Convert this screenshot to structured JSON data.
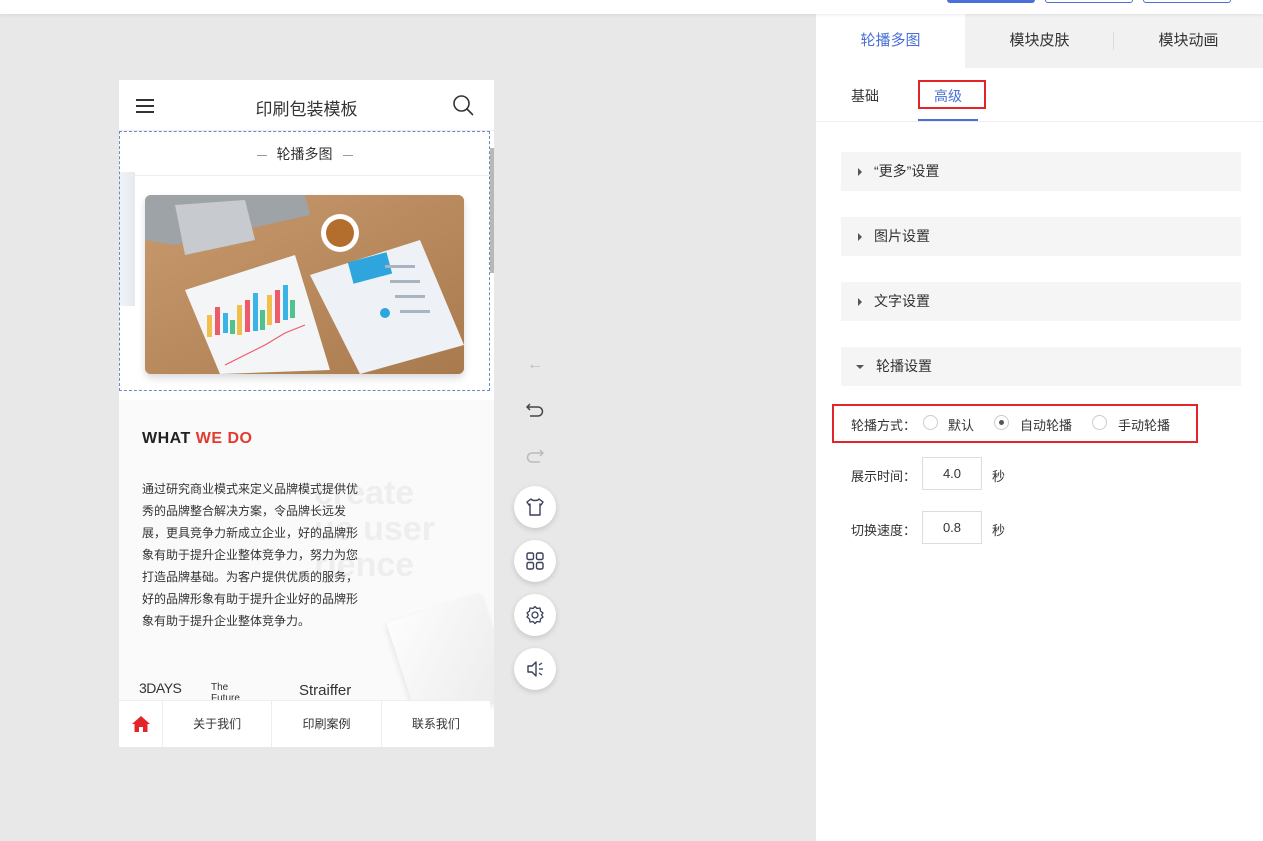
{
  "phone": {
    "title": "印刷包装模板",
    "carousel_title": "轮播多图",
    "wwd_prefix": "WHAT ",
    "wwd_highlight": "WE DO",
    "bg_line1": "create",
    "bg_line2": "ue user",
    "bg_line3": "rience",
    "paragraph": "通过研究商业模式来定义品牌模式提供优秀的品牌整合解决方案，令品牌长远发展，更具竞争力新成立企业，好的品牌形象有助于提升企业整体竞争力，努力为您打造品牌基础。为客户提供优质的服务，好的品牌形象有助于提升企业好的品牌形象有助于提升企业整体竞争力。",
    "logos": {
      "logo1": "3DAYS",
      "logo2": "The Future",
      "logo3": "Straiffer"
    },
    "footer_nav": [
      "关于我们",
      "印刷案例",
      "联系我们"
    ]
  },
  "panel": {
    "tabs": [
      "轮播多图",
      "模块皮肤",
      "模块动画"
    ],
    "subtabs": [
      "基础",
      "高级"
    ],
    "sections": [
      "“更多”设置",
      "图片设置",
      "文字设置",
      "轮播设置"
    ],
    "carousel_mode_label": "轮播方式：",
    "carousel_modes": [
      "默认",
      "自动轮播",
      "手动轮播"
    ],
    "display_time_label": "展示时间：",
    "display_time_value": "4.0",
    "switch_speed_label": "切换速度：",
    "switch_speed_value": "0.8",
    "unit": "秒"
  },
  "colors": {
    "accent": "#4a6fd8",
    "highlight_red": "#e0262a",
    "brand_red": "#e33a2f"
  },
  "icons": [
    "menu-icon",
    "search-icon",
    "home-icon",
    "arrow-left-icon",
    "undo-icon",
    "redo-icon",
    "shirt-icon",
    "grid-icon",
    "gear-icon",
    "speaker-icon"
  ]
}
